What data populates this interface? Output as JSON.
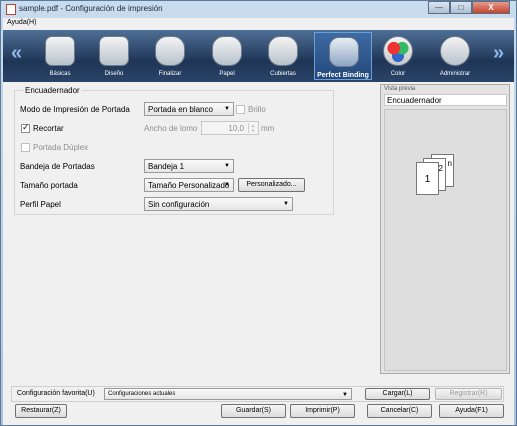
{
  "window": {
    "title": "sample.pdf - Configuración de impresión",
    "min_icon": "minimize-icon",
    "max_icon": "maximize-icon",
    "close_glyph": "X"
  },
  "menu": {
    "help": "Ayuda(H)"
  },
  "nav": {
    "left_arrow": "«",
    "right_arrow": "»"
  },
  "tabs": [
    {
      "label": "Básicas",
      "icon": "basic-settings-icon"
    },
    {
      "label": "Diseño",
      "icon": "layout-icon"
    },
    {
      "label": "Finalizar",
      "icon": "finishing-icon"
    },
    {
      "label": "Papel",
      "icon": "paper-icon"
    },
    {
      "label": "Cubiertas",
      "icon": "covers-icon"
    },
    {
      "label": "Perfect Binding",
      "icon": "perfect-binding-icon",
      "active": true
    },
    {
      "label": "Color",
      "icon": "color-icon"
    },
    {
      "label": "Administrar",
      "icon": "manage-icon"
    }
  ],
  "group": {
    "title": "Encuadernador",
    "cover_mode_label": "Modo de Impresión de Portada",
    "cover_mode_value": "Portada en blanco",
    "brillo_label": "Brillo",
    "recortar_label": "Recortar",
    "recortar_checked": true,
    "spine_width_label": "Ancho de lomo",
    "spine_width_value": "10,0",
    "spine_unit": "mm",
    "duplex_cover_label": "Portada Dúplex",
    "cover_tray_label": "Bandeja de Portadas",
    "cover_tray_value": "Bandeja 1",
    "cover_size_label": "Tamaño portada",
    "cover_size_value": "Tamaño Personalizado",
    "custom_button": "Personalizado...",
    "paper_profile_label": "Perfil Papel",
    "paper_profile_value": "Sin configuración"
  },
  "preview": {
    "title": "Vista previa",
    "subtitle": "Encuadernador",
    "page_labels": [
      "1",
      "2",
      "n"
    ]
  },
  "footer": {
    "favorite_label": "Configuración favorita(U)",
    "favorite_value": "Configuraciones actuales",
    "load_button": "Cargar(L)",
    "register_button": "Registrar(R)",
    "restore_button": "Restaurar(Z)",
    "save_button": "Guardar(S)",
    "print_button": "Imprimir(P)",
    "cancel_button": "Cancelar(C)",
    "help_button": "Ayuda(F1)"
  },
  "colors": {
    "title_bg": "#c9dcef",
    "iconbar_bg": "#1f3556",
    "active_tab": "#3d6aa2",
    "close_button": "#c6432c"
  }
}
